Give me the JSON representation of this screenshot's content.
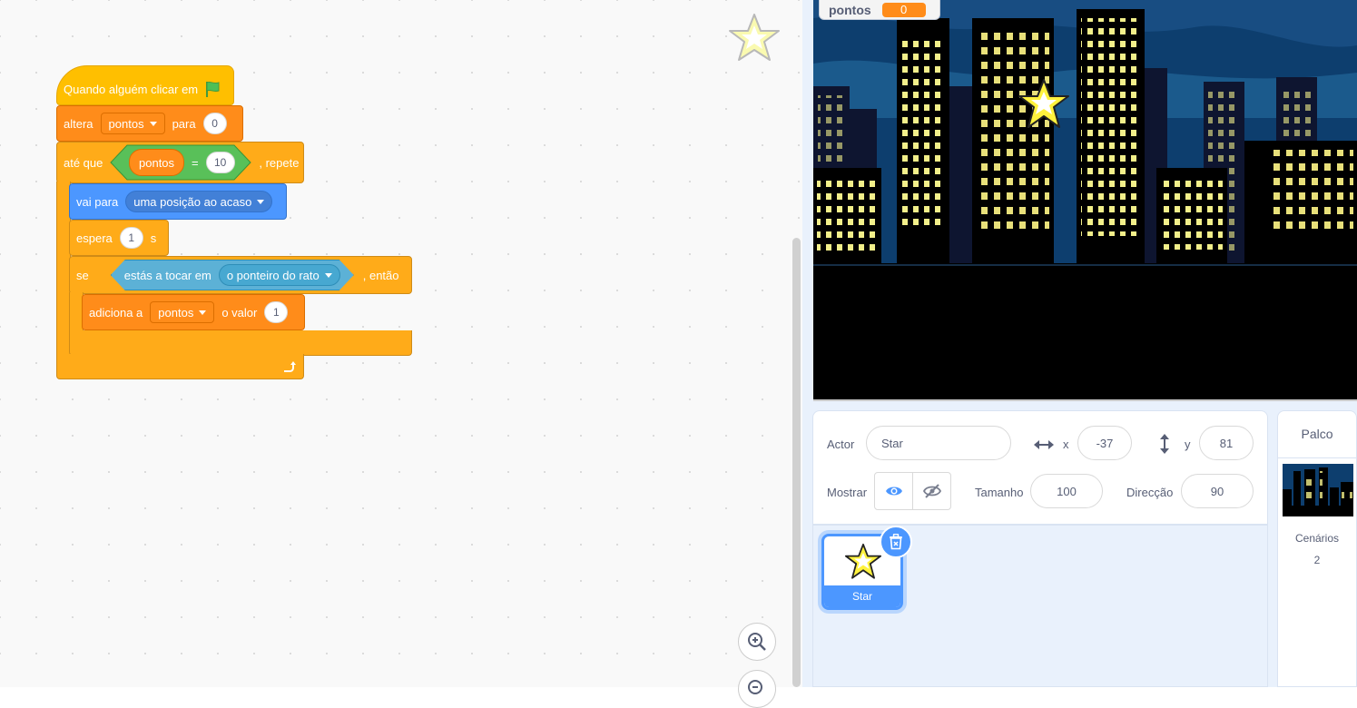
{
  "variable_monitor": {
    "name": "pontos",
    "value": "0"
  },
  "script": {
    "when_flag_clicked": "Quando alguém clicar em",
    "set_var": {
      "prefix": "altera",
      "variable": "pontos",
      "middle": "para",
      "value": "0"
    },
    "repeat_until": {
      "prefix": "até que",
      "left": "pontos",
      "operator": "=",
      "right": "10",
      "suffix": ", repete"
    },
    "go_to": {
      "prefix": "vai para",
      "target": "uma posição ao acaso"
    },
    "wait": {
      "prefix": "espera",
      "value": "1",
      "suffix": "s"
    },
    "if_touching": {
      "prefix": "se",
      "sensing": "estás a tocar em",
      "object": "o ponteiro do rato",
      "suffix": ", então"
    },
    "change_var": {
      "prefix": "adiciona a",
      "variable": "pontos",
      "middle": "o valor",
      "value": "1"
    }
  },
  "sprite_info": {
    "sprite_label": "Actor",
    "sprite_name": "Star",
    "x_label": "x",
    "x_value": "-37",
    "y_label": "y",
    "y_value": "81",
    "show_label": "Mostrar",
    "size_label": "Tamanho",
    "size_value": "100",
    "direction_label": "Direcção",
    "direction_value": "90"
  },
  "sprites": [
    {
      "name": "Star",
      "selected": true
    }
  ],
  "stage_panel": {
    "title": "Palco",
    "backdrops_label": "Cenários",
    "backdrops_count": "2"
  },
  "colors": {
    "events": "#ffbf00",
    "variables": "#ff8c1a",
    "control": "#ffab19",
    "motion": "#4c97ff",
    "sensing": "#5cb1d6",
    "operators": "#59c059",
    "accent": "#4c97ff"
  },
  "icons": [
    "green-flag-icon",
    "dropdown-caret-icon",
    "loop-arrow-icon",
    "horizontal-arrows-icon",
    "vertical-arrows-icon",
    "eye-icon",
    "eye-slash-icon",
    "trash-icon",
    "zoom-in-icon",
    "zoom-out-icon",
    "star-sprite-icon"
  ]
}
